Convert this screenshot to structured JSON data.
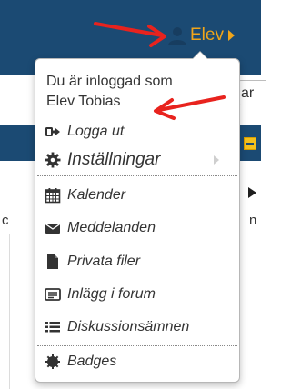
{
  "navbar": {
    "user_label": "Elev",
    "color": "#1b4a73",
    "accent": "#f0a51a"
  },
  "background": {
    "input_fragment": "ar",
    "left_fragment": "c",
    "right_fragment": "n"
  },
  "dropdown": {
    "logged_in_prefix": "Du är inloggad som",
    "user_name": "Elev Tobias",
    "items": [
      {
        "label": "Logga ut",
        "icon": "sign-out-icon"
      },
      {
        "label": "Inställningar",
        "icon": "gear-icon",
        "has_submenu": true
      },
      {
        "label": "Kalender",
        "icon": "calendar-icon"
      },
      {
        "label": "Meddelanden",
        "icon": "envelope-icon"
      },
      {
        "label": "Privata filer",
        "icon": "file-icon"
      },
      {
        "label": "Inlägg i forum",
        "icon": "forum-post-icon"
      },
      {
        "label": "Diskussionsämnen",
        "icon": "list-icon"
      },
      {
        "label": "Badges",
        "icon": "badge-icon"
      }
    ]
  },
  "annotation_color": "#e8231e"
}
